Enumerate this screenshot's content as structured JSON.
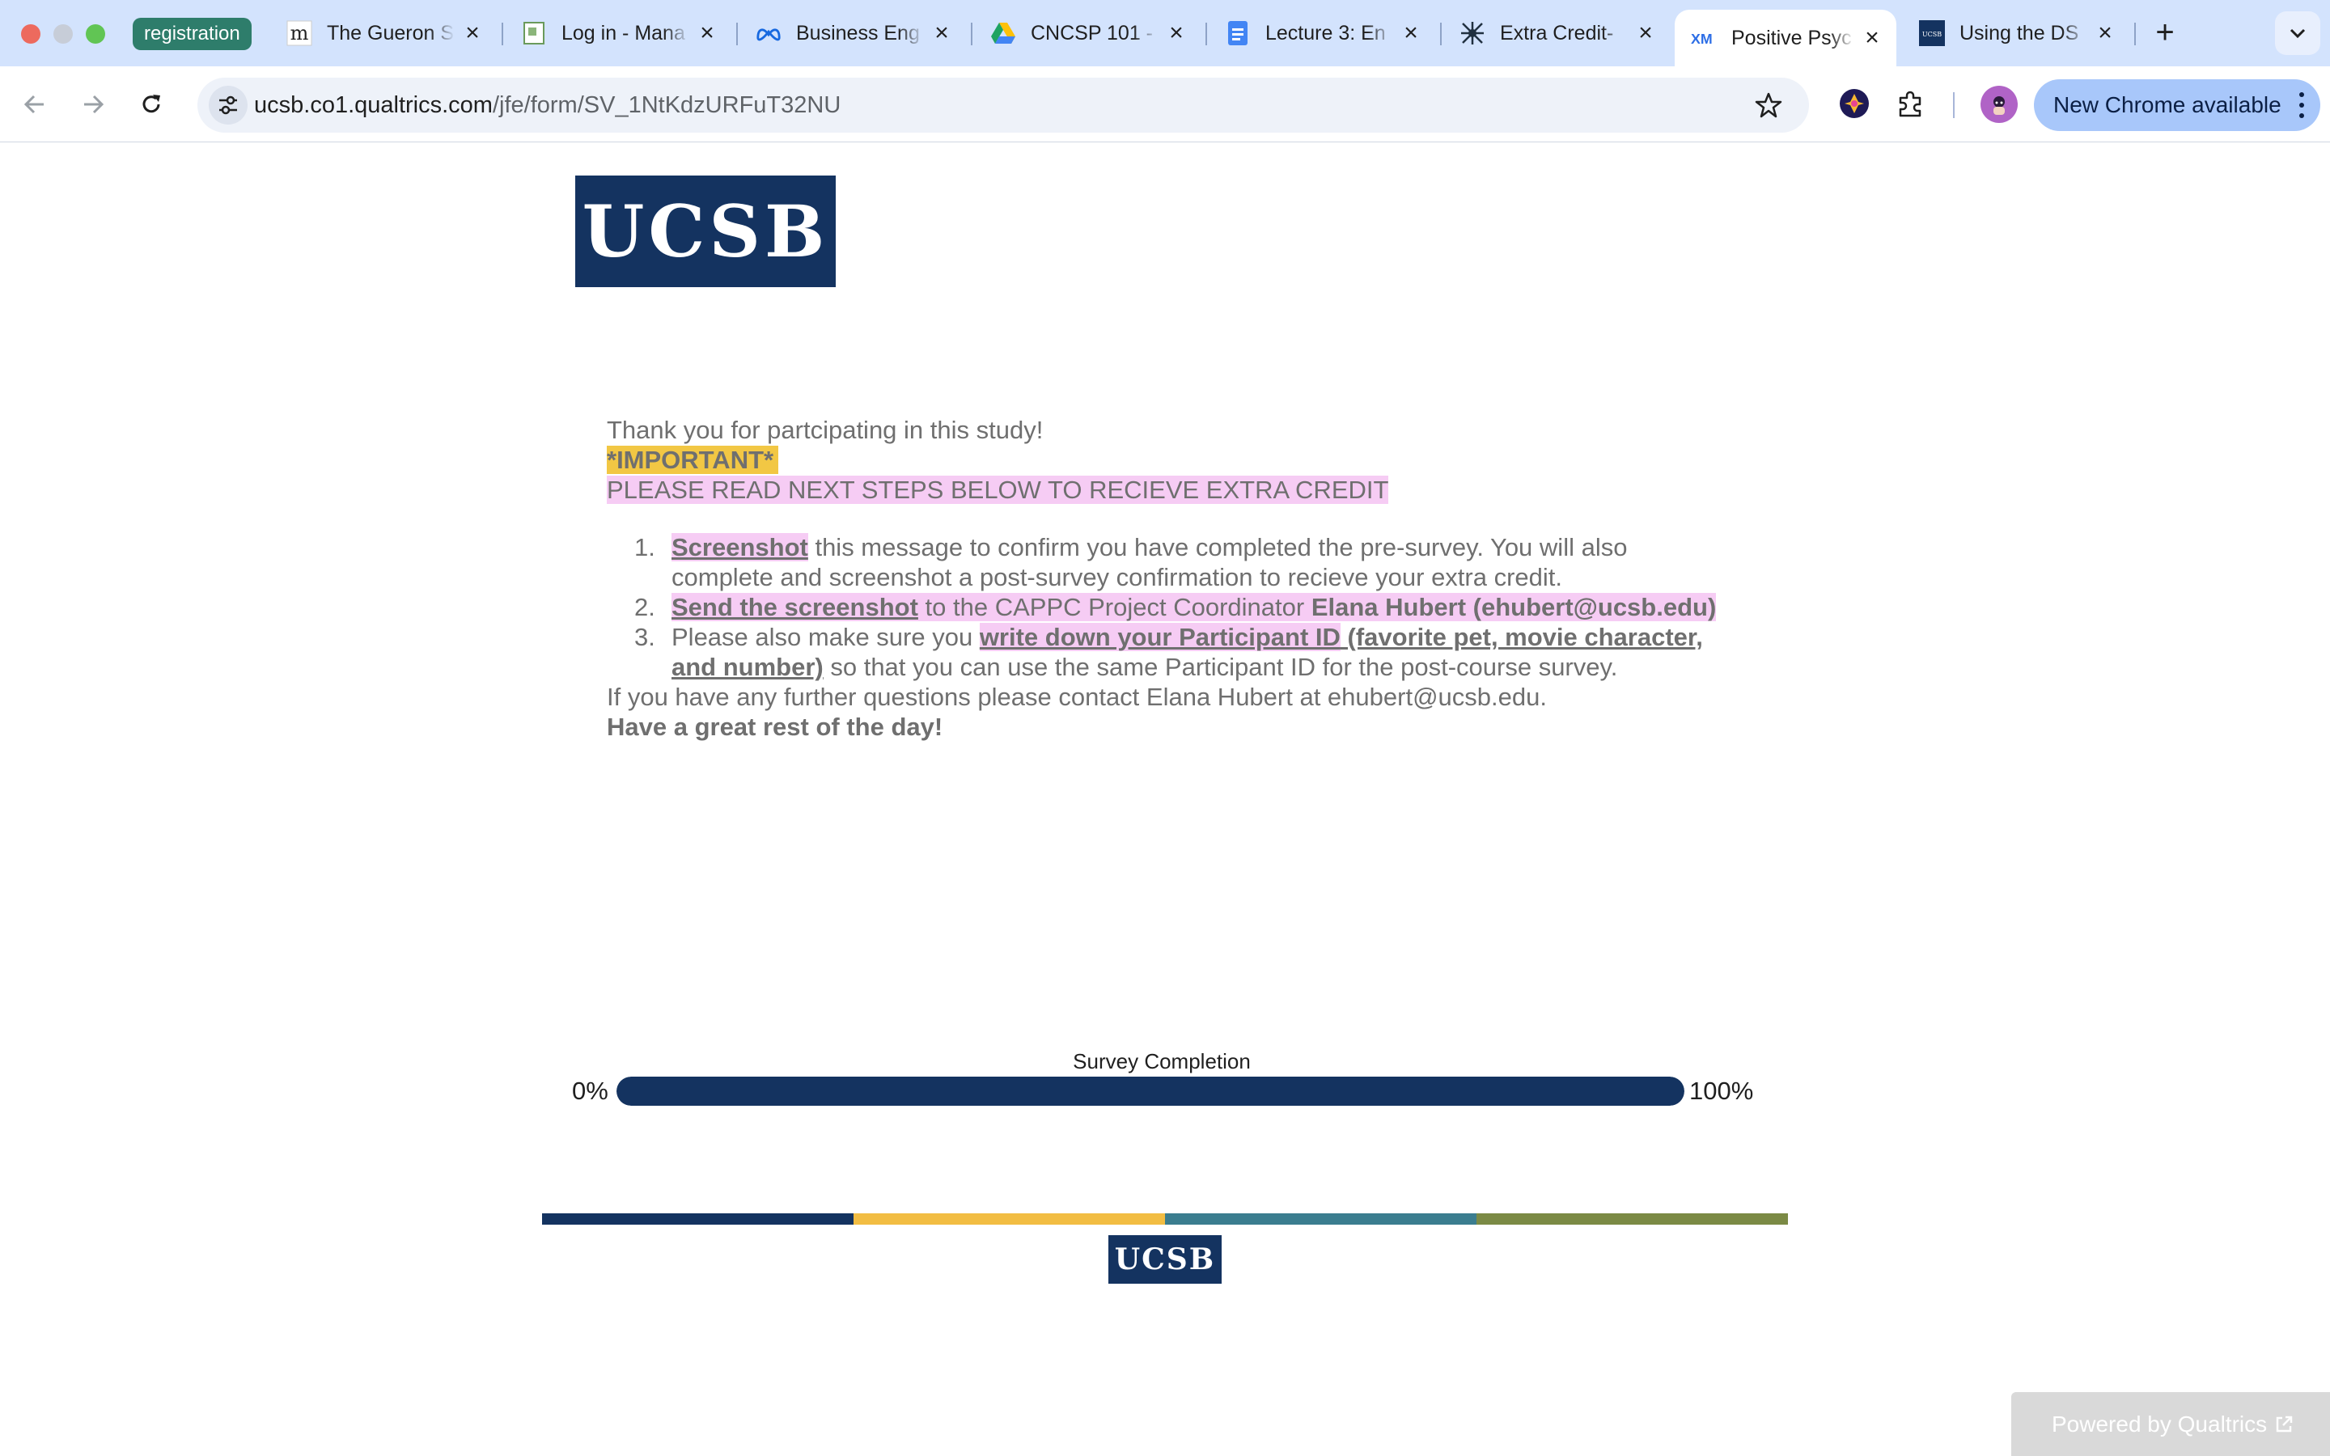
{
  "browser": {
    "tab_group": "registration",
    "tabs": [
      {
        "title": "The Gueron S",
        "icon": "m-letter-icon"
      },
      {
        "title": "Log in - Mana",
        "icon": "document-icon"
      },
      {
        "title": "Business Eng",
        "icon": "meta-icon"
      },
      {
        "title": "CNCSP 101 -",
        "icon": "google-drive-icon"
      },
      {
        "title": "Lecture 3: En",
        "icon": "google-docs-icon"
      },
      {
        "title": "Extra Credit-",
        "icon": "network-icon"
      },
      {
        "title": "Positive Psyc",
        "icon": "xm-icon"
      },
      {
        "title": "Using the DS",
        "icon": "ucsb-icon"
      }
    ],
    "url_host": "ucsb.co1.qualtrics.com",
    "url_path": "/jfe/form/SV_1NtKdzURFuT32NU",
    "update_label": "New Chrome available"
  },
  "page": {
    "logo_text": "UCSB",
    "thanks": "Thank you for partcipating in this study!",
    "important": "*IMPORTANT*",
    "read_next": "PLEASE READ NEXT STEPS BELOW TO RECIEVE EXTRA CREDIT",
    "steps": [
      {
        "num": "1.",
        "link": "Screenshot",
        "rest": " this message to confirm you have completed the pre-survey. You will also complete and screenshot a post-survey confirmation to recieve your extra credit."
      },
      {
        "num": "2.",
        "link": "Send the screenshot",
        "middle": " to the CAPPC Project Coordinator ",
        "name": "Elana Hubert",
        "email": "(ehubert@ucsb.edu)"
      },
      {
        "num": "3.",
        "lead": "Please also make sure you ",
        "link": "write down your Participant ID",
        "link_cont": " (favorite pet, movie character, and number)",
        "rest": " so that you can use the same Participant ID for the post-course survey."
      }
    ],
    "contact": "If you have any further questions please contact Elana Hubert at ehubert@ucsb.edu.",
    "goodbye": "Have a great rest of the day!",
    "progress": {
      "label": "Survey Completion",
      "start": "0%",
      "end": "100%",
      "value_percent": 100
    },
    "footer_logo": "UCSB",
    "footer_colors": [
      "#143360",
      "#f2bd43",
      "#3b7d8f",
      "#7b8a45"
    ],
    "powered_by": "Powered by Qualtrics"
  },
  "colors": {
    "brand_navy": "#143360",
    "highlight_yellow": "#f2c744",
    "highlight_pink": "#f6ccf4"
  }
}
